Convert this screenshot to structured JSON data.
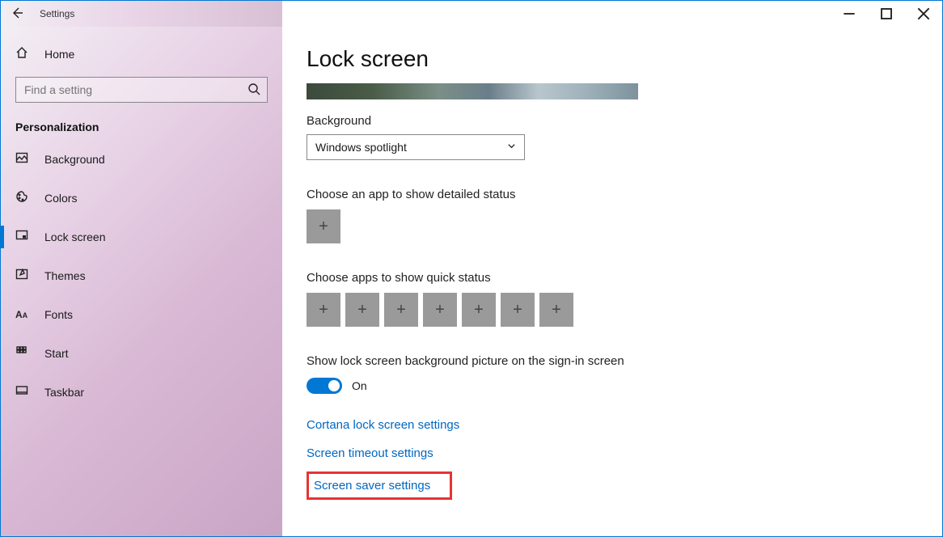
{
  "titlebar": {
    "title": "Settings"
  },
  "sidebar": {
    "home_label": "Home",
    "search_placeholder": "Find a setting",
    "section_label": "Personalization",
    "items": [
      {
        "label": "Background",
        "icon": "image-icon"
      },
      {
        "label": "Colors",
        "icon": "palette-icon"
      },
      {
        "label": "Lock screen",
        "icon": "lockscreen-icon",
        "selected": true
      },
      {
        "label": "Themes",
        "icon": "themes-icon"
      },
      {
        "label": "Fonts",
        "icon": "fonts-icon"
      },
      {
        "label": "Start",
        "icon": "start-icon"
      },
      {
        "label": "Taskbar",
        "icon": "taskbar-icon"
      }
    ]
  },
  "main": {
    "page_title": "Lock screen",
    "background_label": "Background",
    "background_value": "Windows spotlight",
    "detailed_status_label": "Choose an app to show detailed status",
    "quick_status_label": "Choose apps to show quick status",
    "quick_status_slots": 7,
    "signin_label": "Show lock screen background picture on the sign-in screen",
    "signin_toggle": "On",
    "links": {
      "cortana": "Cortana lock screen settings",
      "timeout": "Screen timeout settings",
      "screensaver": "Screen saver settings"
    }
  }
}
